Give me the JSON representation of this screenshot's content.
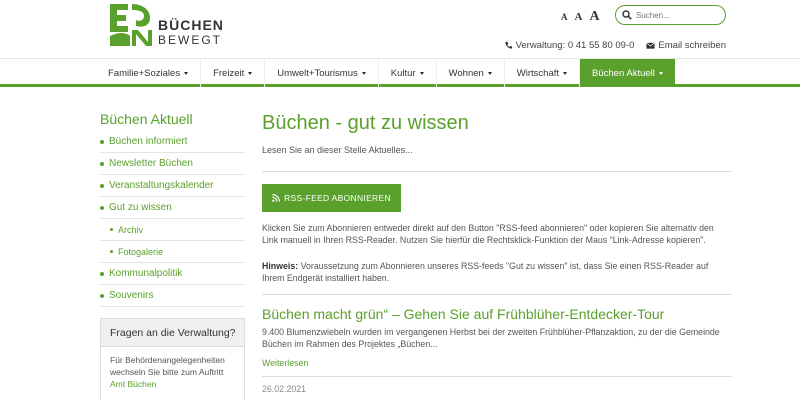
{
  "header": {
    "logo_line1": "BÜCHEN",
    "logo_line2": "BEWEGT",
    "font_sizes": [
      "A",
      "A",
      "A"
    ],
    "search_placeholder": "Suchen...",
    "phone": "Verwaltung: 0 41 55 80 09-0",
    "email": "Email schreiben"
  },
  "nav": {
    "items": [
      {
        "label": "Familie+Soziales"
      },
      {
        "label": "Freizeit"
      },
      {
        "label": "Umwelt+Tourismus"
      },
      {
        "label": "Kultur"
      },
      {
        "label": "Wohnen"
      },
      {
        "label": "Wirtschaft"
      },
      {
        "label": "Büchen Aktuell"
      }
    ]
  },
  "sidebar": {
    "title": "Büchen Aktuell",
    "items": [
      {
        "label": "Büchen informiert"
      },
      {
        "label": "Newsletter Büchen"
      },
      {
        "label": "Veranstaltungskalender"
      },
      {
        "label": "Gut zu wissen"
      },
      {
        "label": "Archiv"
      },
      {
        "label": "Fotogalerie"
      },
      {
        "label": "Kommunalpolitik"
      },
      {
        "label": "Souvenirs"
      }
    ],
    "box_title": "Fragen an die Verwaltung?",
    "box_text": "Für Behördenangelegenheiten wechseln Sie bitte zum Auftritt",
    "box_link": "Amt Büchen"
  },
  "main": {
    "title": "Büchen - gut zu wissen",
    "intro": "Lesen Sie an dieser Stelle Aktuelles...",
    "rss_button": "RSS-FEED ABONNIEREN",
    "rss_info": "Klicken Sie zum Abonnieren entweder direkt auf den Button \"RSS-feed abonnieren\" oder kopieren Sie alternativ den Link manuell in Ihren RSS-Reader. Nutzen Sie hierfür die Rechtsklick-Funktion der Maus \"Link-Adresse kopieren\".",
    "hint_label": "Hinweis:",
    "hint_text": " Voraussetzung zum Abonnieren unseres RSS-feeds \"Gut zu wissen\" ist, dass Sie einen RSS-Reader auf Ihrem Endgerät installiert haben.",
    "article": {
      "title": "Büchen macht grün“ – Gehen Sie auf Frühblüher-Entdecker-Tour",
      "text": "9.400 Blumenzwiebeln wurden im vergangenen Herbst bei der zweiten Frühblüher-Pflanzaktion, zu der die Gemeinde Büchen im Rahmen des Projektes „Büchen...",
      "more": "Weiterlesen",
      "date": "26.02.2021"
    }
  },
  "colors": {
    "accent": "#5aa02c"
  }
}
